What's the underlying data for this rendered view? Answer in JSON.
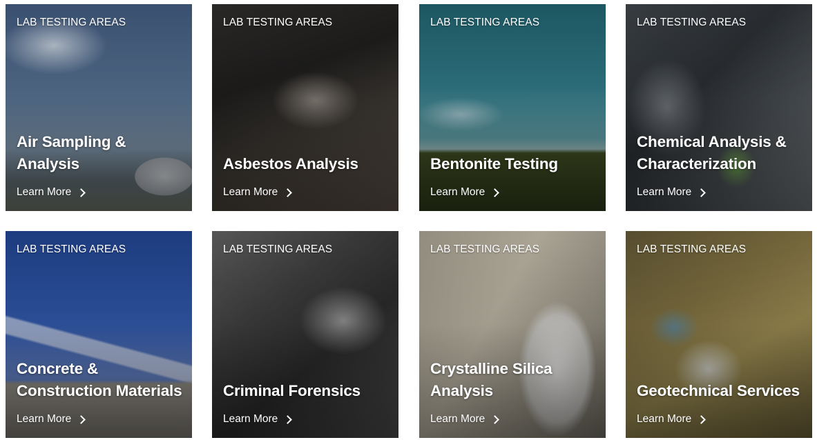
{
  "cards": [
    {
      "kicker": "LAB TESTING AREAS",
      "title": "Air Sampling & Analysis",
      "cta": "Learn More",
      "image": "industrial-refinery-photo"
    },
    {
      "kicker": "LAB TESTING AREAS",
      "title": "Asbestos Analysis",
      "cta": "Learn More",
      "image": "business-laptop-photo"
    },
    {
      "kicker": "LAB TESTING AREAS",
      "title": "Bentonite Testing",
      "cta": "Learn More",
      "image": "drilling-rig-photo"
    },
    {
      "kicker": "LAB TESTING AREAS",
      "title": "Chemical Analysis & Characterization",
      "cta": "Learn More",
      "image": "microscope-lab-photo"
    },
    {
      "kicker": "LAB TESTING AREAS",
      "title": "Concrete & Construction Materials",
      "cta": "Learn More",
      "image": "construction-worker-photo"
    },
    {
      "kicker": "LAB TESTING AREAS",
      "title": "Criminal Forensics",
      "cta": "Learn More",
      "image": "forensic-evidence-photo"
    },
    {
      "kicker": "LAB TESTING AREAS",
      "title": "Crystalline Silica Analysis",
      "cta": "Learn More",
      "image": "lab-scientist-photo"
    },
    {
      "kicker": "LAB TESTING AREAS",
      "title": "Geotechnical Services",
      "cta": "Learn More",
      "image": "soil-sampling-photo"
    }
  ],
  "colors": {
    "text": "#ffffff"
  }
}
